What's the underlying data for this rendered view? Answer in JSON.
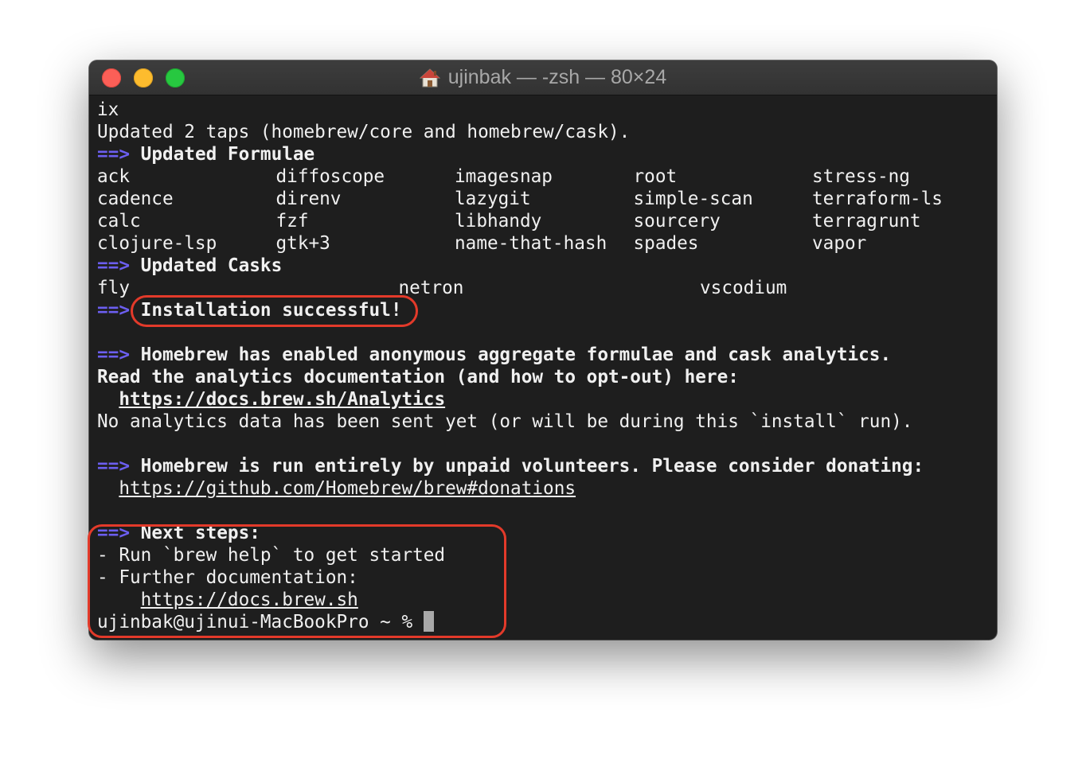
{
  "window": {
    "title": "ujinbak — -zsh — 80×24"
  },
  "terminal": {
    "line_ix": "ix",
    "taps_line": "Updated 2 taps (homebrew/core and homebrew/cask).",
    "arrow": "==>",
    "formulae_header": "Updated Formulae",
    "formulae_rows": [
      [
        "ack",
        "diffoscope",
        "imagesnap",
        "root",
        "stress-ng"
      ],
      [
        "cadence",
        "direnv",
        "lazygit",
        "simple-scan",
        "terraform-ls"
      ],
      [
        "calc",
        "fzf",
        "libhandy",
        "sourcery",
        "terragrunt"
      ],
      [
        "clojure-lsp",
        "gtk+3",
        "name-that-hash",
        "spades",
        "vapor"
      ]
    ],
    "casks_header": "Updated Casks",
    "casks": [
      "fly",
      "netron",
      "vscodium"
    ],
    "install_success": "Installation successful!",
    "analytics_header": "Homebrew has enabled anonymous aggregate formulae and cask analytics.",
    "analytics_read": "Read the analytics documentation (and how to opt-out) here:",
    "analytics_url": "https://docs.brew.sh/Analytics",
    "analytics_note": "No analytics data has been sent yet (or will be during this `install` run).",
    "volunteers_header": "Homebrew is run entirely by unpaid volunteers. Please consider donating:",
    "donations_url": "https://github.com/Homebrew/brew#donations",
    "next_steps_header": "Next steps:",
    "step_run": "- Run `brew help` to get started",
    "step_docs": "- Further documentation:",
    "docs_url": "https://docs.brew.sh",
    "prompt": "ujinbak@ujinui-MacBookPro ~ % "
  },
  "colors": {
    "arrow": "#6c5ff0",
    "annotation": "#e33a2a",
    "background": "#1e1e1e",
    "text": "#f0f0f0"
  },
  "icons": {
    "title_icon": "home-icon"
  }
}
